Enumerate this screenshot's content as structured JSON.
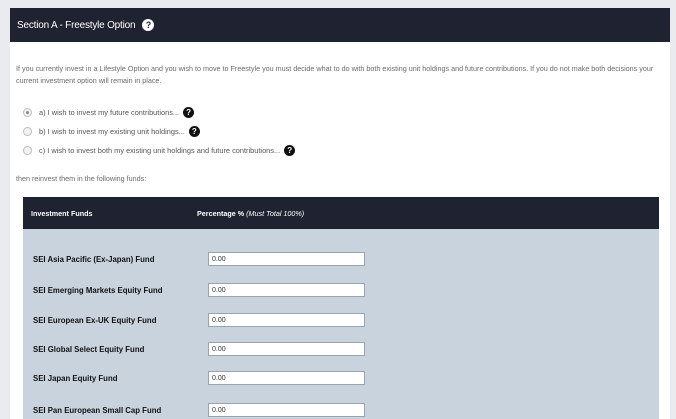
{
  "section": {
    "title": "Section A - Freestyle Option",
    "help_icon": "help-icon"
  },
  "intro_text": "If you currently invest in a Lifestyle Option and you wish to move to Freestyle you must decide what to do with both existing unit holdings and future contributions. If you do not make both decisions your current investment option will remain in place.",
  "options": [
    {
      "label": "a) I wish to invest my future contributions...",
      "selected": true
    },
    {
      "label": "b) I wish to invest my existing unit holdings...",
      "selected": false
    },
    {
      "label": "c) I wish to invest both my existing unit holdings and future contributions...",
      "selected": false
    }
  ],
  "then_text": "then reinvest them in the following funds:",
  "table": {
    "col_funds": "Investment Funds",
    "col_percentage": "Percentage %",
    "col_percentage_note": "(Must Total 100%)",
    "rows": [
      {
        "name": "SEI Asia Pacific (Ex-Japan) Fund",
        "value": "0.00"
      },
      {
        "name": "SEI Emerging Markets Equity Fund",
        "value": "0.00"
      },
      {
        "name": "SEI European Ex-UK Equity Fund",
        "value": "0.00"
      },
      {
        "name": "SEI Global Select Equity Fund",
        "value": "0.00"
      },
      {
        "name": "SEI Japan Equity Fund",
        "value": "0.00"
      },
      {
        "name": "SEI Pan European Small Cap Fund",
        "value": "0.00"
      }
    ]
  },
  "colors": {
    "header_bg": "#1f2230",
    "table_body_bg": "#c9d3de"
  }
}
